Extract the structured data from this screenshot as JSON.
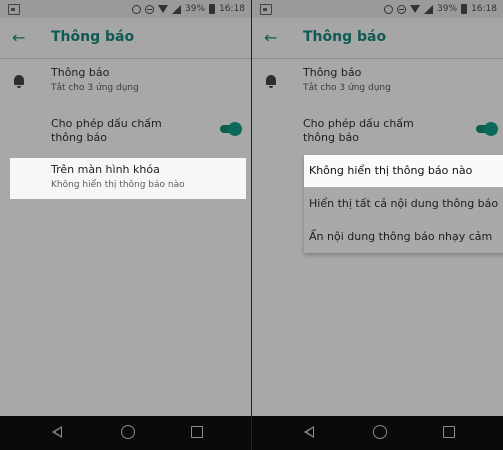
{
  "status_bar": {
    "battery": "39%",
    "time": "16:18"
  },
  "header": {
    "title": "Thông báo"
  },
  "notifications_row": {
    "title": "Thông báo",
    "subtitle": "Tắt cho 3 ứng dụng"
  },
  "dot_row": {
    "title_line1": "Cho phép dấu chấm",
    "title_line2": "thông báo",
    "enabled": true
  },
  "lockscreen_row": {
    "title": "Trên màn hình khóa",
    "subtitle": "Không hiển thị thông báo nào"
  },
  "lockscreen_options": [
    {
      "label": "Không hiển thị thông báo nào",
      "selected": true
    },
    {
      "label": "Hiển thị tất cả nội dung thông báo",
      "selected": false
    },
    {
      "label": "Ẩn nội dung thông báo nhạy cảm",
      "selected": false
    }
  ],
  "colors": {
    "accent": "#0f5a52",
    "dim_background": "#a8a8a8",
    "card": "#f7f7f7"
  }
}
